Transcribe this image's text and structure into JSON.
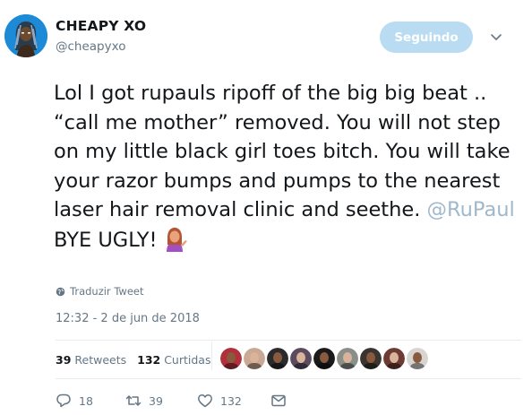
{
  "user": {
    "display_name": "CHEAPY XO",
    "handle": "@cheapyxo"
  },
  "follow_button": {
    "label": "Seguindo"
  },
  "tweet": {
    "text_before": "Lol I got rupauls ripoff of the big big beat .. “call me mother” removed. You will not step on my little black girl toes bitch. You will take your razor bumps and pumps to the nearest laser hair removal clinic and seethe. ",
    "mention": "@RuPaul",
    "text_after": " BYE UGLY!",
    "emoji": "person-tipping-hand"
  },
  "translate_label": "Traduzir Tweet",
  "timestamp": "12:32 - 2 de jun de 2018",
  "stats": {
    "retweets_count": "39",
    "retweets_label": "Retweets",
    "likes_count": "132",
    "likes_label": "Curtidas"
  },
  "liker_avatars": [
    "#b0303c",
    "#c9a894",
    "#2b2b2b",
    "#5a4b5e",
    "#1a1a1a",
    "#8a8f8a",
    "#3a3530",
    "#6e3b34",
    "#d8d4d0"
  ],
  "actions": {
    "reply_count": "18",
    "retweet_count": "39",
    "like_count": "132"
  },
  "colors": {
    "accent": "#1da1f2",
    "follow_bg": "#b9dcf3",
    "secondary_text": "#657786"
  }
}
